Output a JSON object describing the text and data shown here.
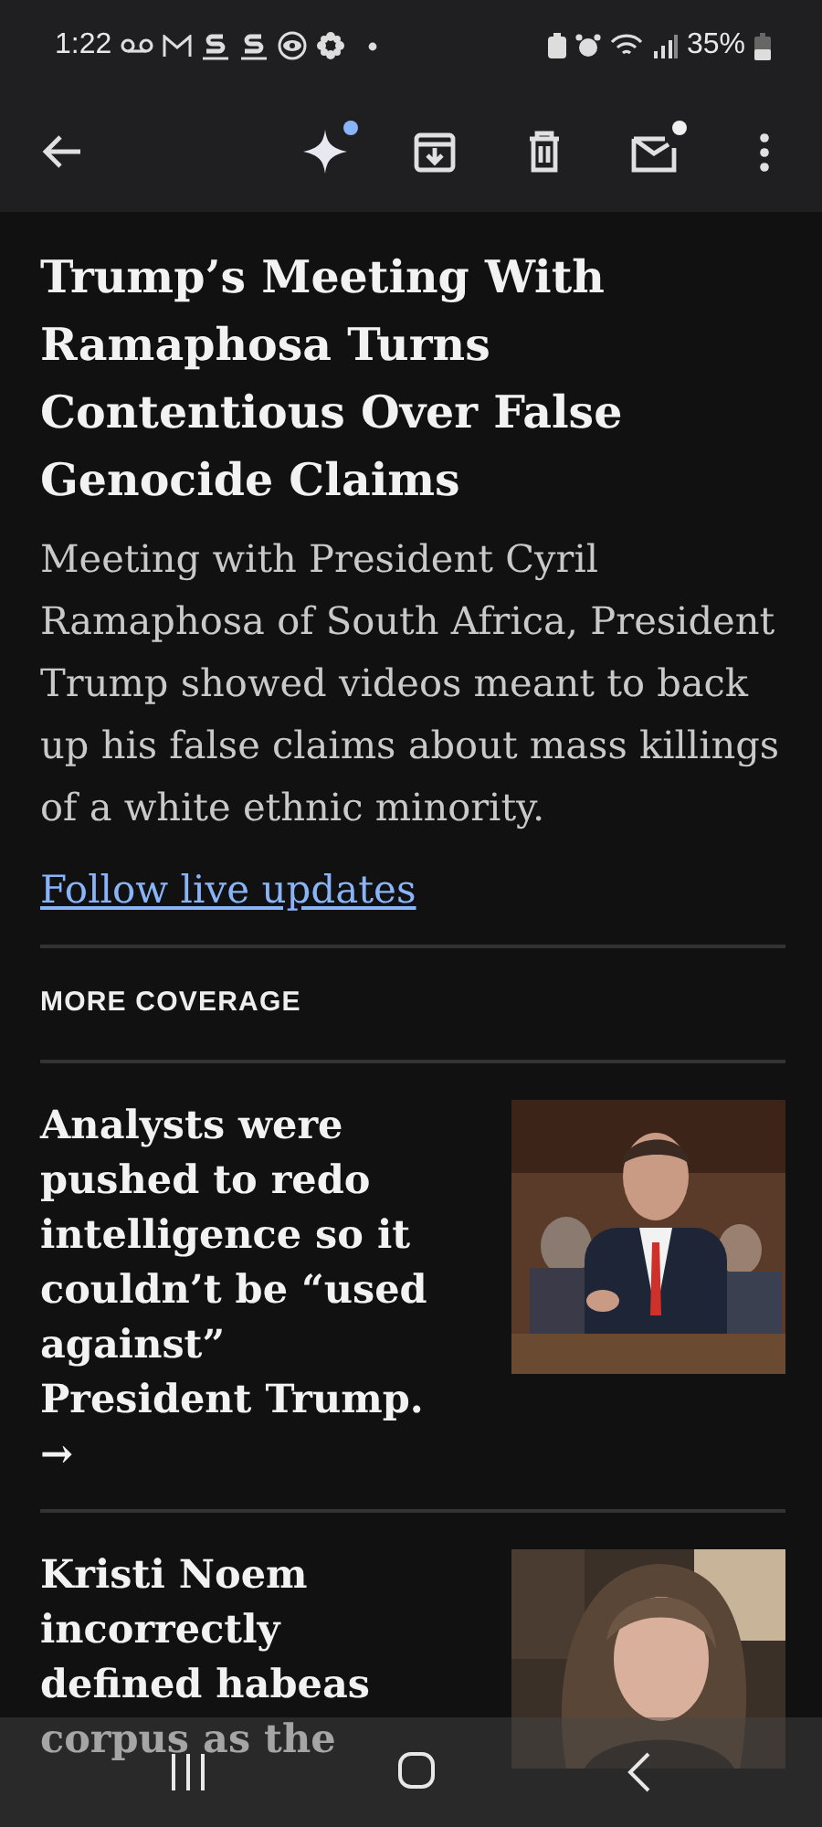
{
  "status_bar": {
    "time": "1:22",
    "battery": "35%"
  },
  "toolbar": {
    "actions": [
      {
        "kind": "sparkle",
        "badge": true
      },
      {
        "kind": "archive",
        "badge": false
      },
      {
        "kind": "delete",
        "badge": false
      },
      {
        "kind": "mail",
        "badge": true
      },
      {
        "kind": "more",
        "badge": false
      }
    ]
  },
  "article": {
    "headline": "Trump’s Meeting With Ramaphosa Turns Contentious Over False Genocide Claims",
    "summary": "Meeting with President Cyril Ramaphosa of South Africa, President Trump showed videos meant to back up his false claims about mass killings of a white ethnic minority.",
    "link": "Follow live updates"
  },
  "more_coverage": {
    "heading": "MORE COVERAGE",
    "items": [
      {
        "headline": "Analysts were pushed to redo intelligence so it couldn’t be “used against” President Trump. →"
      },
      {
        "headline": "Kristi Noem incorrectly defined habeas corpus as the"
      }
    ]
  }
}
